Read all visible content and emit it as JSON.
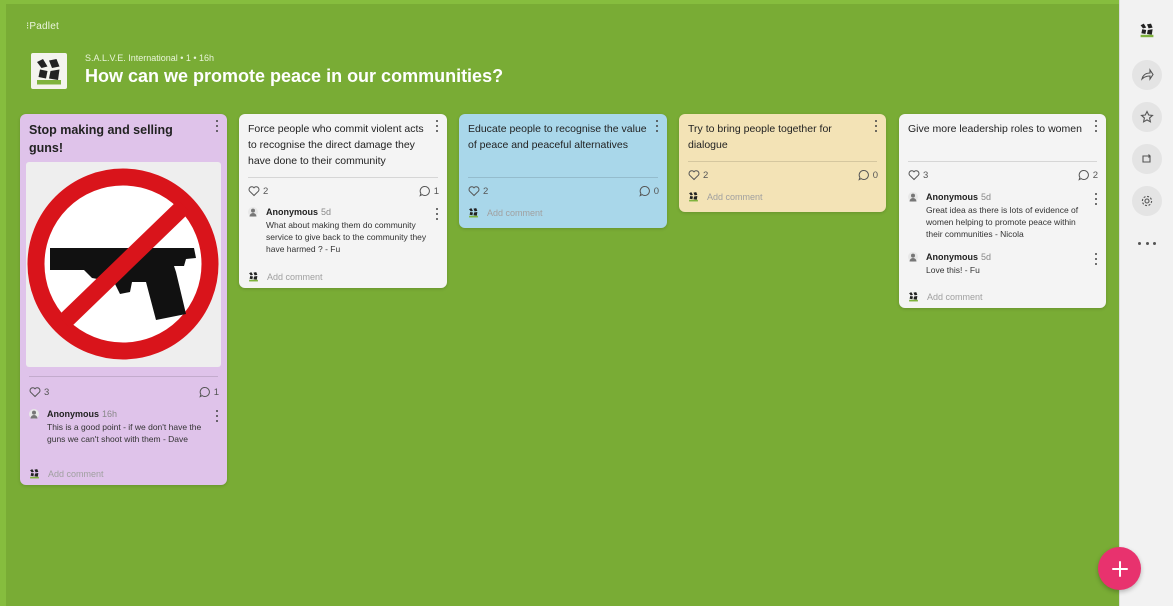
{
  "app": {
    "brand": "⁝Padlet"
  },
  "board": {
    "meta": "S.A.L.V.E. International • 1 • 16h",
    "title": "How can we promote peace in our communities?"
  },
  "colors": {
    "background": "#79ac35",
    "card_purple": "#dfc3ea",
    "card_white": "#f4f4f4",
    "card_blue": "#a9d7ea",
    "card_yellow": "#f3e3b6",
    "fab": "#e8326e"
  },
  "cards": [
    {
      "text": "Stop making and selling guns!",
      "image": "no-guns-sign",
      "likes": "3",
      "comments": "1",
      "comment_list": [
        {
          "author": "Anonymous",
          "time": "16h",
          "body": "This is a good point - if we don't have the guns we can't shoot with them - Dave"
        }
      ],
      "add_comment": "Add comment"
    },
    {
      "text": "Force people who commit violent acts to recognise the direct damage they have done to their community",
      "likes": "2",
      "comments": "1",
      "comment_list": [
        {
          "author": "Anonymous",
          "time": "5d",
          "body": "What about making them do community service to give back to the community they have harmed ? - Fu"
        }
      ],
      "add_comment": "Add comment"
    },
    {
      "text": "Educate people to recognise the value of peace and peaceful alternatives",
      "likes": "2",
      "comments": "0",
      "comment_list": [],
      "add_comment": "Add comment"
    },
    {
      "text": "Try to bring people together for dialogue",
      "likes": "2",
      "comments": "0",
      "comment_list": [],
      "add_comment": "Add comment"
    },
    {
      "text": "Give more leadership roles to women",
      "likes": "3",
      "comments": "2",
      "comment_list": [
        {
          "author": "Anonymous",
          "time": "5d",
          "body": "Great idea as there is lots of evidence of women helping to promote peace within their communities - Nicola"
        },
        {
          "author": "Anonymous",
          "time": "5d",
          "body": "Love this! - Fu"
        }
      ],
      "add_comment": "Add comment"
    }
  ],
  "rail": {
    "items": [
      "profile-icon",
      "share-icon",
      "star-icon",
      "remake-icon",
      "settings-icon",
      "more-icon"
    ]
  },
  "fab": {
    "label": "+"
  }
}
